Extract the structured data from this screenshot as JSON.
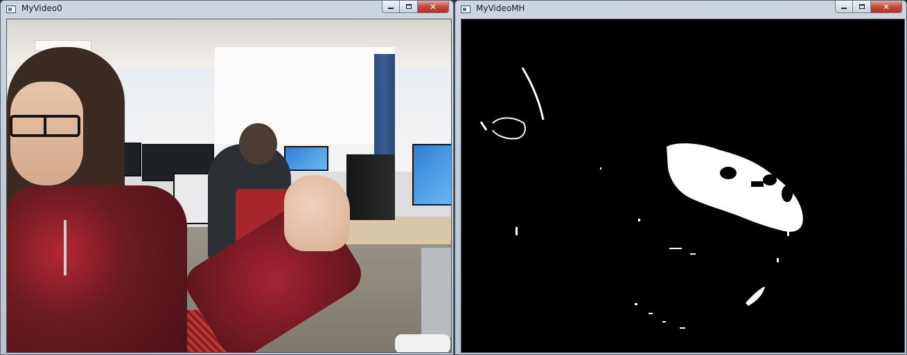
{
  "windows": [
    {
      "title": "MyVideo0",
      "icon": "opencv-window-icon",
      "buttons": {
        "minimize": "minimize",
        "maximize": "maximize",
        "close": "close"
      },
      "content": "webcam-frame"
    },
    {
      "title": "MyVideoMH",
      "icon": "opencv-window-icon",
      "buttons": {
        "minimize": "minimize",
        "maximize": "maximize",
        "close": "close"
      },
      "content": "binary-mask"
    }
  ],
  "colors": {
    "titlebar": "#c9d3dd",
    "close_button": "#c7493a",
    "mask_background": "#000000",
    "mask_foreground": "#ffffff"
  }
}
